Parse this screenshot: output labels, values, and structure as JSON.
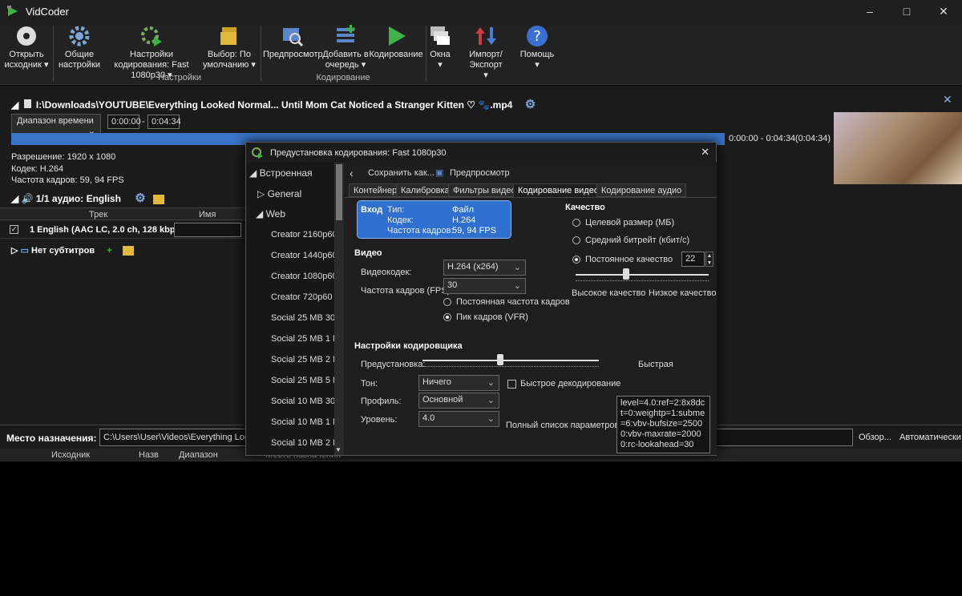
{
  "app": {
    "title": "VidCoder"
  },
  "ribbon": {
    "open_source": "Открыть исходник",
    "general_settings": "Общие настройки",
    "encode_settings": "Настройки кодирования: Fast 1080p30",
    "choose_default": "Выбор: По умолчанию",
    "group_settings": "Настройки",
    "preview": "Предпросмотр",
    "add_to_queue": "Добавить в очередь",
    "encode": "Кодирование",
    "group_encoding": "Кодирование",
    "windows": "Окна",
    "import_export": "Импорт/Экспорт",
    "help": "Помощь"
  },
  "source": {
    "path": "I:\\Downloads\\YOUTUBE\\Everything Looked Normal... Until Mom Cat Noticed a Stranger Kitten ♡ 🐾.mp4",
    "range_mode": "Диапазон времени",
    "start": "0:00:00",
    "dash": "-",
    "end": "0:04:34",
    "range_label": "0:00:00 - 0:04:34",
    "duration": "(0:04:34)",
    "resolution_label": "Разрешение:",
    "resolution": "1920 x 1080",
    "codec_label": "Кодек:",
    "codec": "H.264",
    "fps_label": "Частота кадров:",
    "fps": "59, 94 FPS",
    "audio_title": "1/1 аудио: English",
    "col_track": "Трек",
    "col_name": "Имя",
    "audio_track": "1 English (AAC LC, 2.0 ch, 128 kbps)",
    "no_subtitles": "Нет субтитров"
  },
  "destination": {
    "label": "Место назначения:",
    "path": "C:\\Users\\User\\Videos\\Everything Looked",
    "browse": "Обзор...",
    "auto": "Автоматически"
  },
  "queue": {
    "col_source": "Исходник",
    "col_name": "Назв",
    "col_range": "Диапазон",
    "col_dest": "Место назначения"
  },
  "dialog": {
    "title": "Предустановка кодирования: Fast 1080p30",
    "save_as": "Сохранить как...",
    "preview": "Предпросмотр",
    "tree": {
      "builtin": "Встроенная",
      "general": "General",
      "web": "Web",
      "items": [
        "Creator 2160p60",
        "Creator 1440p60",
        "Creator 1080p60",
        "Creator 720p60",
        "Social 25 MB 30",
        "Social 25 MB 1 M",
        "Social 25 MB 2 M",
        "Social 25 MB 5 M",
        "Social 10 MB 30",
        "Social 10 MB 1 M",
        "Social 10 MB 2 M"
      ]
    },
    "tabs": [
      "Контейнер",
      "Калибровка",
      "Фильтры видео",
      "Кодирование видео",
      "Кодирование аудио"
    ],
    "input": {
      "header": "Вход",
      "type_label": "Тип:",
      "type": "Файл",
      "codec_label": "Кодек:",
      "codec": "H.264",
      "fps_label": "Частота кадров:",
      "fps": "59, 94 FPS"
    },
    "video": {
      "header": "Видео",
      "codec_label": "Видеокодек:",
      "codec": "H.264 (x264)",
      "fps_label": "Частота кадров (FPS):",
      "fps": "30",
      "constant_fps": "Постоянная частота кадров",
      "peak_fps": "Пик кадров (VFR)"
    },
    "quality": {
      "header": "Качество",
      "target_size": "Целевой размер (МБ)",
      "avg_bitrate": "Средний битрейт (кбит/с)",
      "constant_quality": "Постоянное качество",
      "value": "22",
      "slider_fraction": 0.38,
      "high": "Высокое качество",
      "low": "Низкое качество"
    },
    "encoder": {
      "header": "Настройки кодировщика",
      "preset_label": "Предустановка:",
      "preset_fraction": 0.44,
      "preset_value": "Быстрая",
      "tune_label": "Тон:",
      "tune": "Ничего",
      "fast_decode": "Быстрое декодирование",
      "profile_label": "Профиль:",
      "profile": "Основной",
      "level_label": "Уровень:",
      "level": "4.0",
      "full_params_label": "Полный список параметров:",
      "full_params": "level=4.0:ref=2:8x8dct=0:weightp=1:subme=6:vbv-bufsize=25000:vbv-maxrate=20000:rc-lookahead=30"
    }
  }
}
